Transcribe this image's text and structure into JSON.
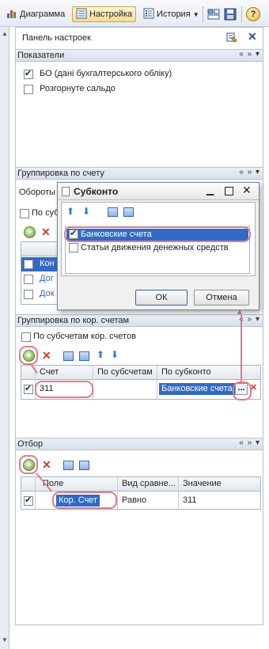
{
  "toolbar": {
    "diagram": "Диаграмма",
    "settings": "Настройка",
    "history": "История",
    "help": "?"
  },
  "panel": {
    "title": "Панель настроек"
  },
  "indicators": {
    "title": "Показатели",
    "items": [
      {
        "label": "БО (дані бухгалтерського обліку)",
        "checked": true
      },
      {
        "label": "Розгорнуте сальдо",
        "checked": false
      }
    ]
  },
  "group_account": {
    "title": "Группировка по счету",
    "turnovers_partial": "Обороты",
    "subaccounts_partial": "По суб",
    "rows_partial": [
      "Кон",
      "Дог",
      "Док"
    ]
  },
  "group_corr": {
    "title": "Группировка по кор. счетам",
    "subaccounts_label": "По субсчетам кор. счетов",
    "columns": [
      "Счет",
      "По субсчетам",
      "По субконто"
    ],
    "row": {
      "account": "311",
      "subaccounts": "",
      "subconto": "Банковские счета"
    }
  },
  "filter": {
    "title": "Отбор",
    "columns": [
      "Поле",
      "Вид сравне...",
      "Значение"
    ],
    "row": {
      "field": "Кор. Счет",
      "comparison": "Равно",
      "value": "311"
    }
  },
  "dialog": {
    "title": "Субконто",
    "items": [
      {
        "label": "Банковские счета",
        "checked": true
      },
      {
        "label": "Статьи движения денежных средств",
        "checked": false
      }
    ],
    "ok": "ОК",
    "cancel": "Отмена"
  },
  "colors": {
    "accent": "#316ac5",
    "callout": "#e27a8a",
    "header": "#dde3ec"
  }
}
